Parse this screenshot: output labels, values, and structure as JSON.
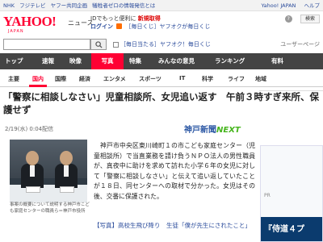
{
  "topbar": {
    "items": [
      "NHK",
      "フジテレビ",
      "ヤフー共同企画",
      "犠牲者ゼロの情報発信とは"
    ],
    "right": [
      "Yahoo! JAPAN",
      "ヘルプ"
    ]
  },
  "header": {
    "logo": "YAHOO!",
    "logo_sub": "JAPAN",
    "section": "ニュース",
    "promo_line1_prefix": "IDでもっと便利に",
    "promo_line1_link": "新規取得",
    "promo_login": "ログイン",
    "promo_gift": "［毎日くじ］ヤフオクが毎日くじ",
    "help_glyph": "?",
    "search_label": "検索"
  },
  "search": {
    "placeholder": "",
    "bookmark": "［毎日当たる］ヤフオク！毎日くじ",
    "yafuoku": "",
    "ad_label": "ユーザーページ"
  },
  "nav": {
    "items": [
      "トップ",
      "速報",
      "映像",
      "写真",
      "特集",
      "みんなの意見",
      "ランキング",
      "有料"
    ]
  },
  "subnav": {
    "items": [
      "主要",
      "国内",
      "国際",
      "経済",
      "エンタメ",
      "スポーツ",
      "IT",
      "科学",
      "ライフ",
      "地域"
    ]
  },
  "article": {
    "headline": "「警察に相談しなさい」児童相談所、女児追い返す　午前３時すぎ来所、保護せず",
    "date": "2/19(水) 0:04配信",
    "publisher": "神戸新聞",
    "publisher_tag": "NEXT",
    "body": "神戸市中央区東川崎町１の市こども家庭センター（児童相談所）で当直業務を請け負うＮＰＯ法人の男性職員が、真夜中に助けを求めて訪れた小学６年の女児に対して「警察に相談しなさい」と伝えて追い返していたことが１８日、同センターへの取材で分かった。女児はその後、交番に保護された。",
    "caption": "事案の概要について説明する神戸市こども家庭センターの職員ら＝神戸市役所",
    "related_photo": "【写真】高校生飛び降り　生徒「僕が先生にされたこと」"
  },
  "sidebar": {
    "pr": "PR",
    "banner": "『侍道４プ"
  }
}
